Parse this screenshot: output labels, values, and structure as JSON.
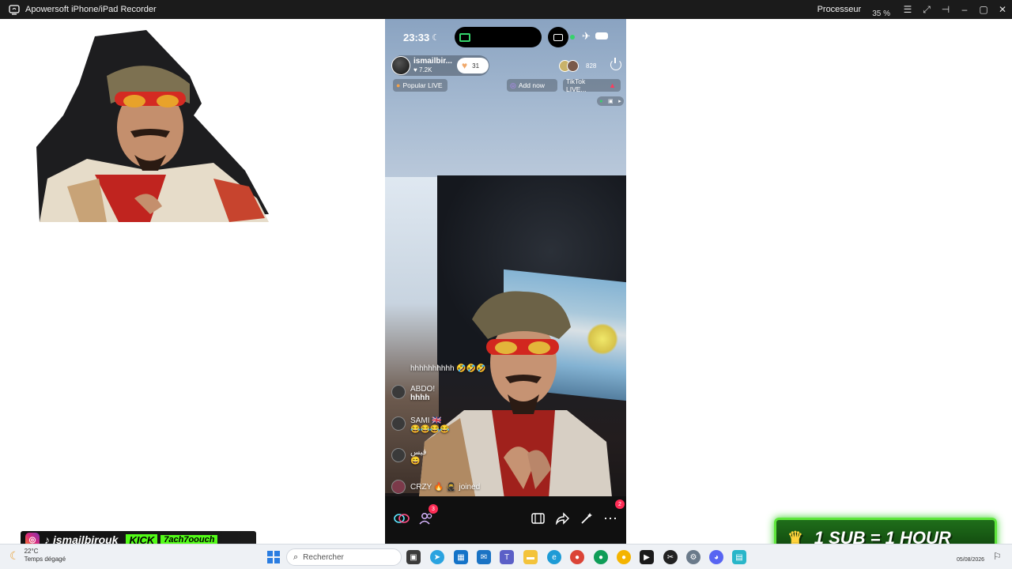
{
  "window": {
    "title": "Apowersoft iPhone/iPad Recorder",
    "cpu_label": "Processeur",
    "cpu_value": "35 %"
  },
  "phone": {
    "status": {
      "time": "23:33"
    },
    "host": {
      "name": "ismailbir...",
      "likes": "7.2K",
      "coins": "31"
    },
    "viewers_count": "828",
    "chips": {
      "popular": "Popular LIVE",
      "add_now": "Add now",
      "tiktok_live": "TikTok LIVE..."
    },
    "comments": [
      {
        "name": "",
        "message": "hhhhhhhhhh 🤣🤣🤣"
      },
      {
        "name": "ABDO!",
        "message": "hhhh"
      },
      {
        "name": "SAMI 🇬🇧",
        "message": "😂😂😂😂"
      },
      {
        "name": "قيس",
        "message": "😄"
      },
      {
        "name": "CRZY 🔥 🥷",
        "message": "joined"
      }
    ],
    "bottom": {
      "guests_badge": "3",
      "more_badge": "2"
    }
  },
  "overlays": {
    "social_handle": "ismailbirouk",
    "kick_label": "KICK",
    "kick_handle": "7ach7oouch",
    "sub_banner": "1 SUB = 1 HOUR"
  },
  "taskbar": {
    "weather_temp": "22°C",
    "weather_desc": "Temps dégagé",
    "search_placeholder": "Rechercher",
    "date": "05/08/2026"
  },
  "colors": {
    "tiktok_red": "#fe2c55",
    "kick_green": "#53fc18",
    "sub_banner_green": "#1f6e1a",
    "windows_blue": "#2a7de1"
  }
}
